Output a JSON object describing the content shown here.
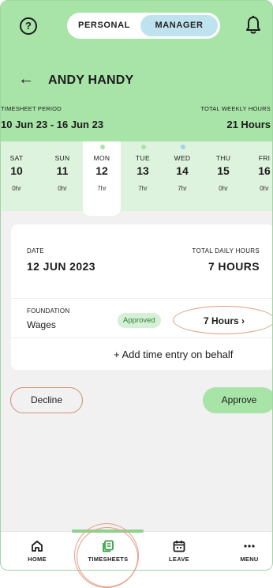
{
  "topbar": {
    "toggle_personal": "PERSONAL",
    "toggle_manager": "MANAGER",
    "active_toggle": "MANAGER"
  },
  "header": {
    "employee_name": "ANDY HANDY",
    "period_label": "TIMESHEET PERIOD",
    "period_value": "10 Jun 23 - 16 Jun 23",
    "weekly_label": "TOTAL WEEKLY HOURS",
    "weekly_value": "21 Hours"
  },
  "days": [
    {
      "name": "SAT",
      "date": "10",
      "hours": "0hr",
      "dot": null
    },
    {
      "name": "SUN",
      "date": "11",
      "hours": "0hr",
      "dot": null
    },
    {
      "name": "MON",
      "date": "12",
      "hours": "7hr",
      "dot": "#a8e3a8",
      "selected": true
    },
    {
      "name": "TUE",
      "date": "13",
      "hours": "7hr",
      "dot": "#a8e3a8"
    },
    {
      "name": "WED",
      "date": "14",
      "hours": "7hr",
      "dot": "#9fd3ea"
    },
    {
      "name": "THU",
      "date": "15",
      "hours": "0hr",
      "dot": null
    },
    {
      "name": "FRI",
      "date": "16",
      "hours": "0hr",
      "dot": null
    }
  ],
  "detail": {
    "date_label": "DATE",
    "date_value": "12 JUN 2023",
    "daily_label": "TOTAL DAILY HOURS",
    "daily_value": "7 HOURS",
    "entry_category": "FOUNDATION",
    "entry_name": "Wages",
    "entry_status": "Approved",
    "entry_hours": "7 Hours",
    "add_entry": "+ Add time entry on behalf"
  },
  "actions": {
    "decline": "Decline",
    "approve": "Approve"
  },
  "nav": {
    "home": "HOME",
    "timesheets": "TIMESHEETS",
    "leave": "LEAVE",
    "menu": "MENU",
    "active": "TIMESHEETS"
  },
  "colors": {
    "brand_green": "#a8e3a8",
    "light_green": "#ddf3dd",
    "manager_blue": "#bfe3ee",
    "annotation": "#e09a7a"
  }
}
